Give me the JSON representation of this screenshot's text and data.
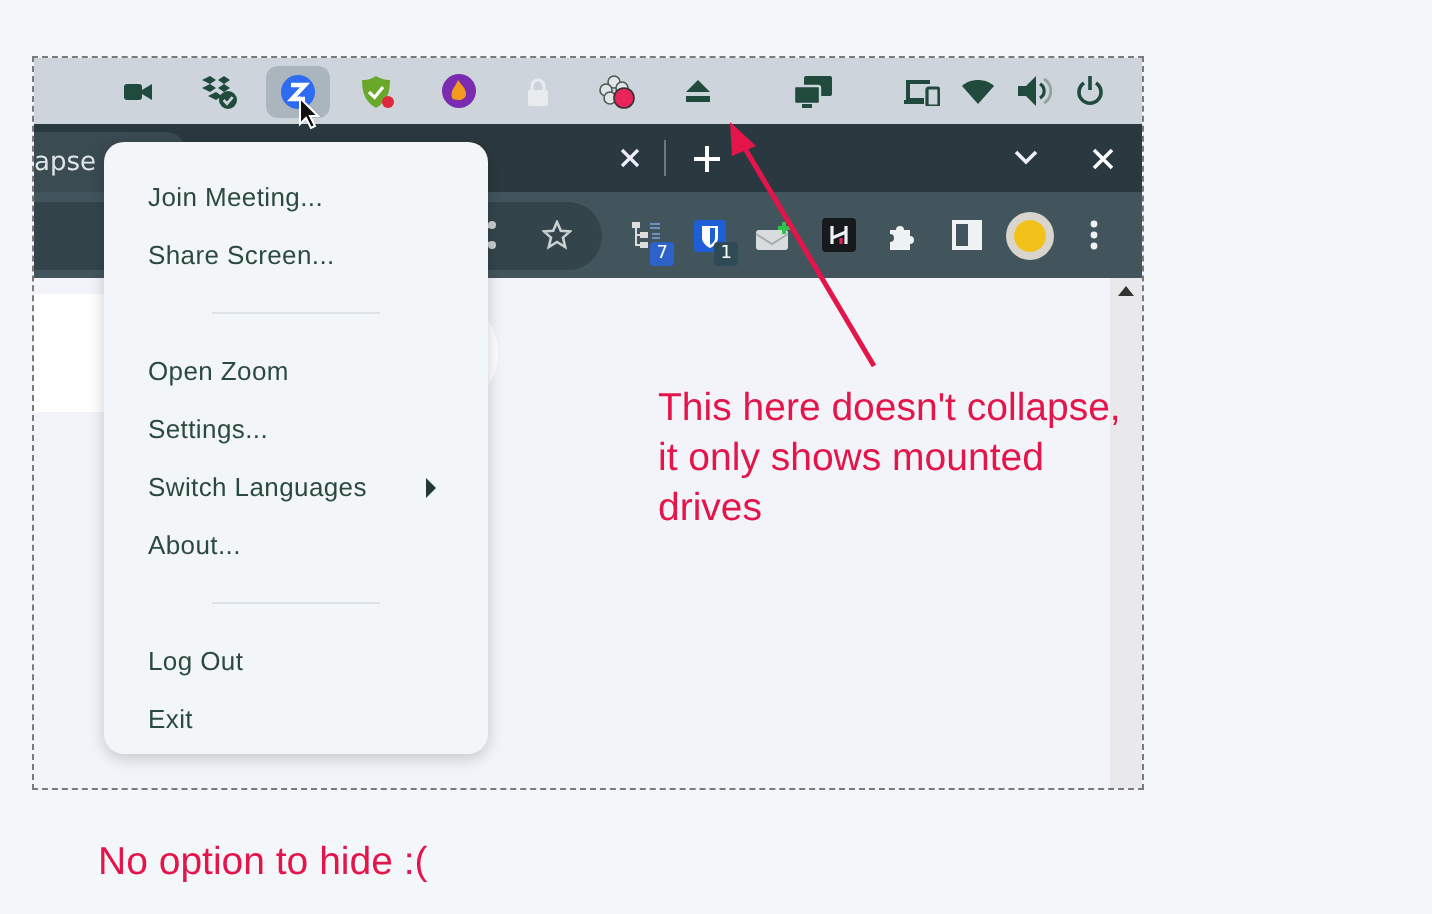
{
  "tray": {
    "icons": [
      {
        "kind": "camera",
        "selected": false
      },
      {
        "kind": "boxes-check",
        "selected": false
      },
      {
        "kind": "zoom",
        "selected": true
      },
      {
        "kind": "shield-check",
        "selected": false
      },
      {
        "kind": "flame-circle",
        "selected": false
      },
      {
        "kind": "lock",
        "selected": false
      },
      {
        "kind": "flower-dot",
        "selected": false
      },
      {
        "kind": "eject",
        "selected": false
      },
      {
        "kind": "screens",
        "selected": false
      },
      {
        "kind": "devices",
        "selected": false
      },
      {
        "kind": "wifi",
        "selected": false
      },
      {
        "kind": "volume",
        "selected": false
      },
      {
        "kind": "power",
        "selected": false
      }
    ]
  },
  "browser": {
    "tab": {
      "title": "apse"
    },
    "extensions": [
      {
        "kind": "tree",
        "badge": "7"
      },
      {
        "kind": "shield",
        "badge": "1"
      },
      {
        "kind": "mail"
      },
      {
        "kind": "dark-tile"
      },
      {
        "kind": "puzzle"
      },
      {
        "kind": "side-panel"
      },
      {
        "kind": "avatar"
      },
      {
        "kind": "more"
      }
    ]
  },
  "menu": {
    "items": [
      {
        "kind": "item",
        "label": "Join Meeting..."
      },
      {
        "kind": "item",
        "label": "Share Screen..."
      },
      {
        "kind": "separator"
      },
      {
        "kind": "item",
        "label": "Open Zoom"
      },
      {
        "kind": "item",
        "label": "Settings..."
      },
      {
        "kind": "submenu",
        "label": "Switch Languages"
      },
      {
        "kind": "item",
        "label": "About..."
      },
      {
        "kind": "separator"
      },
      {
        "kind": "item",
        "label": "Log Out"
      },
      {
        "kind": "item",
        "label": "Exit"
      }
    ]
  },
  "annotations": {
    "arrow_note": "This here doesn't collapse, it only shows mounted drives",
    "caption": "No option to hide :("
  }
}
